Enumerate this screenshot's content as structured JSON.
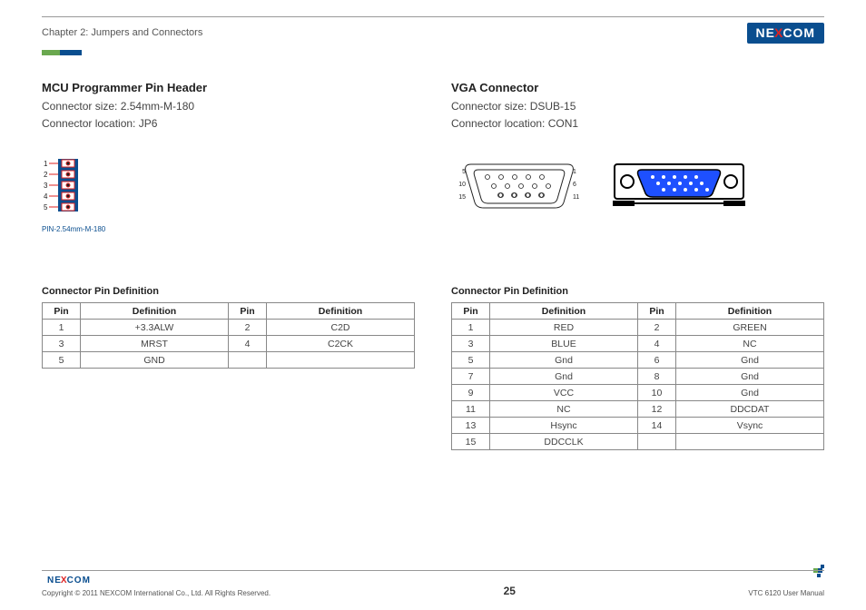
{
  "header": {
    "chapter": "Chapter 2: Jumpers and Connectors",
    "logo_text_left": "NE",
    "logo_text_x": "X",
    "logo_text_right": "COM"
  },
  "left": {
    "title": "MCU Programmer Pin Header",
    "size_label": "Connector size: 2.54mm-M-180",
    "loc_label": "Connector location: JP6",
    "diagram_caption": "PIN-2.54mm-M-180",
    "pin_numbers": [
      "1",
      "2",
      "3",
      "4",
      "5"
    ],
    "table_title": "Connector Pin Definition",
    "th_pin": "Pin",
    "th_def": "Definition",
    "rows": [
      {
        "p1": "1",
        "d1": "+3.3ALW",
        "p2": "2",
        "d2": "C2D"
      },
      {
        "p1": "3",
        "d1": "MRST",
        "p2": "4",
        "d2": "C2CK"
      },
      {
        "p1": "5",
        "d1": "GND",
        "p2": "",
        "d2": ""
      }
    ]
  },
  "right": {
    "title": "VGA Connector",
    "size_label": "Connector size: DSUB-15",
    "loc_label": "Connector location: CON1",
    "db15_labels": {
      "tl": "5",
      "tr": "1",
      "ml": "10",
      "mr": "6",
      "bl": "15",
      "br": "11"
    },
    "table_title": "Connector Pin Definition",
    "th_pin": "Pin",
    "th_def": "Definition",
    "rows": [
      {
        "p1": "1",
        "d1": "RED",
        "p2": "2",
        "d2": "GREEN"
      },
      {
        "p1": "3",
        "d1": "BLUE",
        "p2": "4",
        "d2": "NC"
      },
      {
        "p1": "5",
        "d1": "Gnd",
        "p2": "6",
        "d2": "Gnd"
      },
      {
        "p1": "7",
        "d1": "Gnd",
        "p2": "8",
        "d2": "Gnd"
      },
      {
        "p1": "9",
        "d1": "VCC",
        "p2": "10",
        "d2": "Gnd"
      },
      {
        "p1": "11",
        "d1": "NC",
        "p2": "12",
        "d2": "DDCDAT"
      },
      {
        "p1": "13",
        "d1": "Hsync",
        "p2": "14",
        "d2": "Vsync"
      },
      {
        "p1": "15",
        "d1": "DDCCLK",
        "p2": "",
        "d2": ""
      }
    ]
  },
  "footer": {
    "copyright": "Copyright © 2011 NEXCOM International Co., Ltd. All Rights Reserved.",
    "page_number": "25",
    "manual": "VTC 6120 User Manual"
  }
}
